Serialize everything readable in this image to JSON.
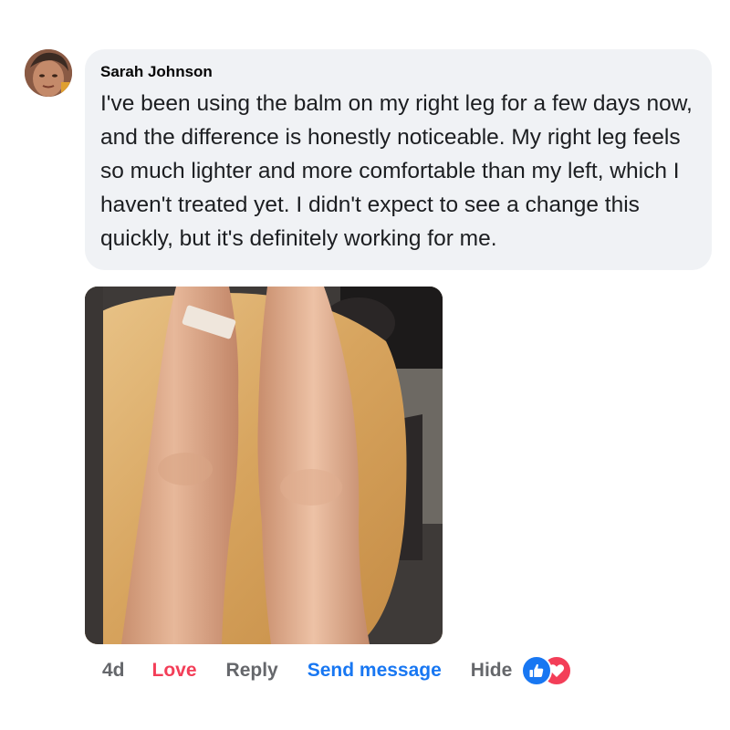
{
  "comment": {
    "author": "Sarah Johnson",
    "text": "I've been using the balm on my right leg for a few days now, and the difference is honestly noticeable. My right leg feels so much lighter and more comfortable than my left, which I haven't treated yet. I didn't expect to see a change this quickly, but it's definitely working for me.",
    "avatar_icon": "profile-photo",
    "photo_icon": "legs-photo"
  },
  "actions": {
    "timestamp": "4d",
    "love_label": "Love",
    "reply_label": "Reply",
    "send_message_label": "Send message",
    "hide_label": "Hide"
  },
  "reactions": {
    "types": [
      "like",
      "love"
    ],
    "like_color": "#1877f2",
    "love_color": "#f33e58"
  },
  "colors": {
    "bubble_bg": "#f0f2f5",
    "love": "#f33e58",
    "link": "#1877f2",
    "muted": "#65676b"
  }
}
